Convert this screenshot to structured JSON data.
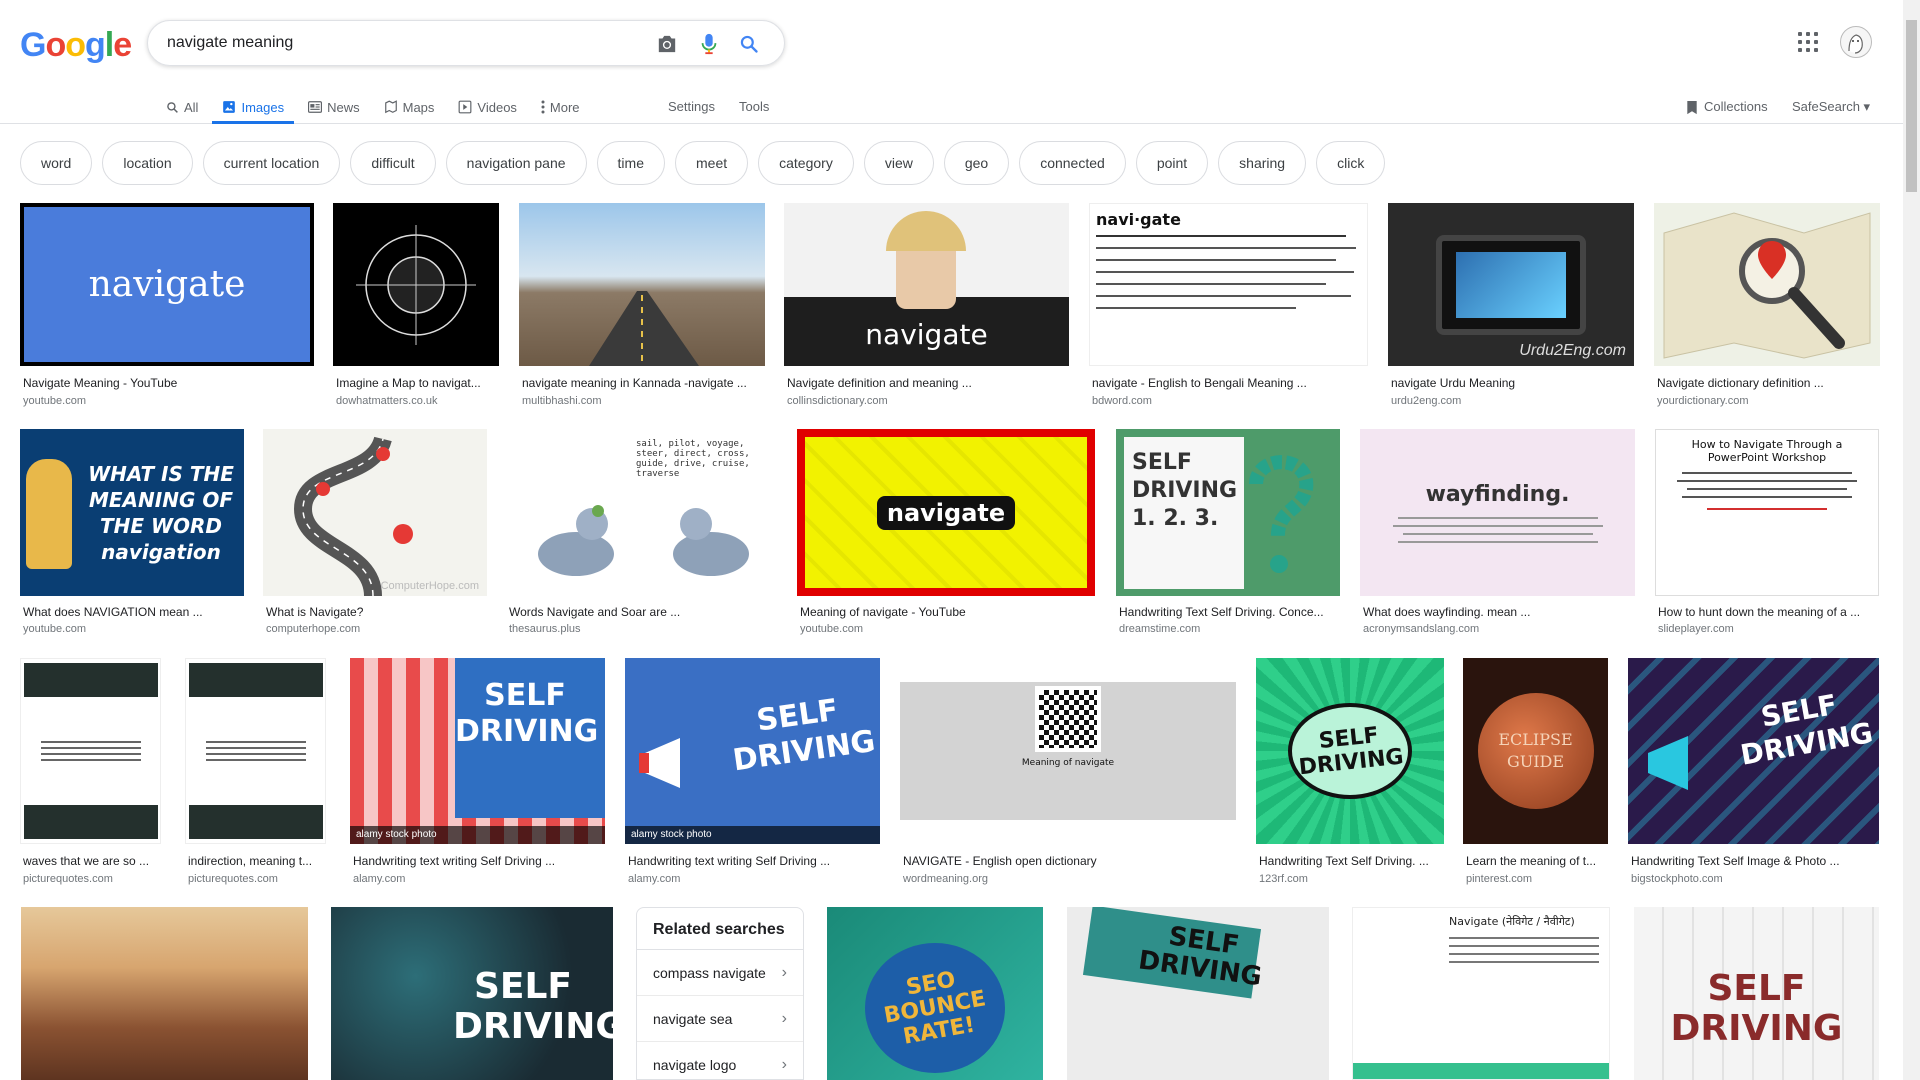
{
  "header": {
    "logo": [
      "G",
      "o",
      "o",
      "g",
      "l",
      "e"
    ],
    "search_query": "navigate meaning",
    "nav_tabs": [
      {
        "label": "All",
        "icon": "search-icon"
      },
      {
        "label": "Images",
        "icon": "image-icon"
      },
      {
        "label": "News",
        "icon": "news-icon"
      },
      {
        "label": "Maps",
        "icon": "map-icon"
      },
      {
        "label": "Videos",
        "icon": "video-icon"
      },
      {
        "label": "More",
        "icon": "more-vert-icon"
      }
    ],
    "settings_label": "Settings",
    "tools_label": "Tools",
    "collections_label": "Collections",
    "safesearch_label": "SafeSearch ▾"
  },
  "chips": [
    "word",
    "location",
    "current location",
    "difficult",
    "navigation pane",
    "time",
    "meet",
    "category",
    "view",
    "geo",
    "connected",
    "point",
    "sharing",
    "click"
  ],
  "results": [
    {
      "title": "Navigate Meaning - YouTube",
      "domain": "youtube.com",
      "text": "navigate"
    },
    {
      "title": "Imagine a Map to navigat...",
      "domain": "dowhatmatters.co.uk"
    },
    {
      "title": "navigate meaning in Kannada -navigate ...",
      "domain": "multibhashi.com"
    },
    {
      "title": "Navigate definition and meaning ...",
      "domain": "collinsdictionary.com",
      "text": "navigate"
    },
    {
      "title": "navigate - English to Bengali Meaning ...",
      "domain": "bdword.com",
      "text": "navi·gate"
    },
    {
      "title": "navigate Urdu Meaning",
      "domain": "urdu2eng.com",
      "text": "Urdu2Eng.com"
    },
    {
      "title": "Navigate dictionary definition ...",
      "domain": "yourdictionary.com"
    },
    {
      "title": "What does NAVIGATION mean ...",
      "domain": "youtube.com",
      "text": "WHAT IS THE MEANING OF THE WORD navigation"
    },
    {
      "title": "What is Navigate?",
      "domain": "computerhope.com",
      "text": "ComputerHope.com"
    },
    {
      "title": "Words Navigate and Soar are ...",
      "domain": "thesaurus.plus",
      "text": "sail, pilot, voyage, steer, direct, cross, guide, drive, cruise, traverse"
    },
    {
      "title": "Meaning of navigate - YouTube",
      "domain": "youtube.com",
      "text": "navigate"
    },
    {
      "title": "Handwriting Text Self Driving. Conce...",
      "domain": "dreamstime.com",
      "text": "SELF DRIVING 1. 2. 3."
    },
    {
      "title": "What does wayfinding. mean ...",
      "domain": "acronymsandslang.com",
      "text": "wayfinding."
    },
    {
      "title": "How to hunt down the meaning of a ...",
      "domain": "slideplayer.com",
      "text": "How to Navigate Through a PowerPoint Workshop"
    },
    {
      "title": "waves that we are so ...",
      "domain": "picturequotes.com"
    },
    {
      "title": "indirection, meaning t...",
      "domain": "picturequotes.com"
    },
    {
      "title": "Handwriting text writing Self Driving ...",
      "domain": "alamy.com",
      "text": "SELF DRIVING"
    },
    {
      "title": "Handwriting text writing Self Driving ...",
      "domain": "alamy.com",
      "text": "SELF DRIVING"
    },
    {
      "title": "NAVIGATE - English open dictionary",
      "domain": "wordmeaning.org",
      "text": "Meaning of navigate"
    },
    {
      "title": "Handwriting Text Self Driving. ...",
      "domain": "123rf.com",
      "text": "SELF DRIVING"
    },
    {
      "title": "Learn the meaning of t...",
      "domain": "pinterest.com",
      "text": "ECLIPSE GUIDE"
    },
    {
      "title": "Handwriting Text Self Image & Photo ...",
      "domain": "bigstockphoto.com",
      "text": "SELF DRIVING"
    },
    {
      "text": ""
    },
    {
      "text": "SELF DRIVING"
    },
    {
      "text": "SEO BOUNCE RATE!"
    },
    {
      "text": "SELF DRIVING"
    },
    {
      "text": "Navigate (नेविगेट / नैवीगेट)"
    },
    {
      "text": "SELF DRIVING"
    }
  ],
  "alamy_watermark": "alamy stock photo",
  "related": {
    "heading": "Related searches",
    "items": [
      "compass navigate",
      "navigate sea",
      "navigate logo"
    ]
  },
  "colors": {
    "accent": "#1a73e8",
    "google_blue": "#4285f4",
    "google_red": "#ea4335",
    "google_yellow": "#fbbc05",
    "google_green": "#34a853"
  }
}
